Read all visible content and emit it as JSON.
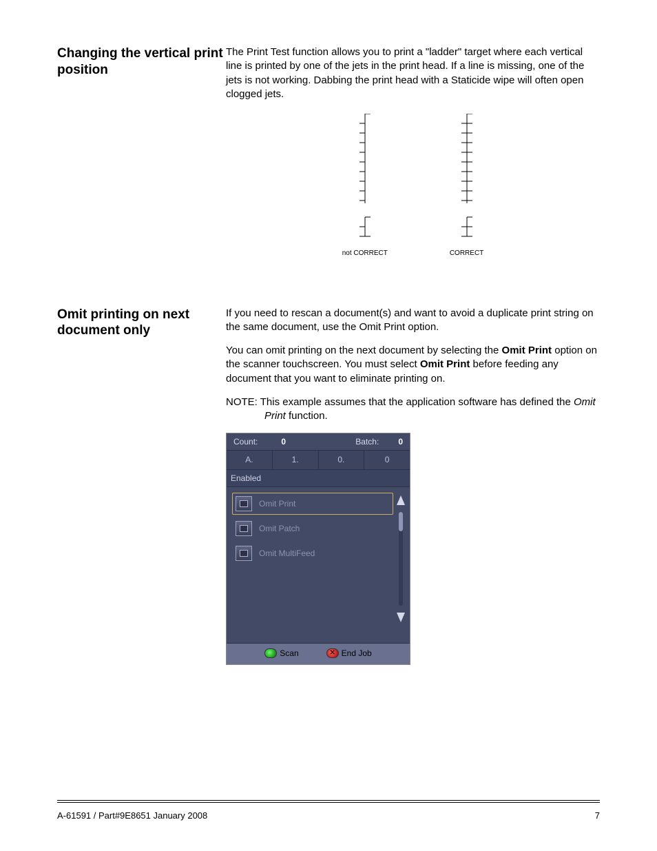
{
  "section1": {
    "heading": "Changing the vertical print position",
    "para1": "The Print Test function allows you to print a \"ladder\" target where each vertical line is printed by one of the jets in the print head. If a line is missing, one of the jets is not working. Dabbing the print head with a Staticide wipe will often open clogged jets.",
    "ladder_left_label": "not CORRECT",
    "ladder_right_label": "CORRECT"
  },
  "section2": {
    "heading": "Omit printing on next document only",
    "para1": "If you need to rescan a document(s) and want to avoid a duplicate print string on the same document, use the Omit Print option.",
    "para2_a": "You can omit printing on the next document by selecting the ",
    "para2_b": "Omit Print",
    "para2_c": " option on the scanner touchscreen. You must select ",
    "para2_d": "Omit Print",
    "para2_e": " before feeding any document that you want to eliminate printing on.",
    "note_a": "NOTE: This example assumes that the application software has defined the ",
    "note_b": "Omit Print",
    "note_c": " function."
  },
  "touchscreen": {
    "count_label": "Count:",
    "count_value": "0",
    "batch_label": "Batch:",
    "batch_value": "0",
    "tabs": [
      "A.",
      "1.",
      "0.",
      "0"
    ],
    "enabled_label": "Enabled",
    "items": [
      {
        "label": "Omit Print",
        "selected": true
      },
      {
        "label": "Omit Patch",
        "selected": false
      },
      {
        "label": "Omit MultiFeed",
        "selected": false
      }
    ],
    "scan_label": "Scan",
    "endjob_label": "End Job"
  },
  "footer": {
    "left": "A-61591 / Part#9E8651   January 2008",
    "right": "7"
  }
}
